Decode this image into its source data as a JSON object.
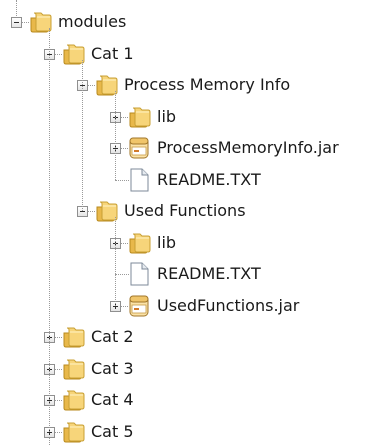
{
  "tree": {
    "label": "modules",
    "icon": "folder-icon",
    "expanded": true,
    "children": [
      {
        "label": "Cat 1",
        "icon": "folder-icon",
        "expanded": true,
        "children": [
          {
            "label": "Process Memory Info",
            "icon": "folder-icon",
            "expanded": true,
            "children": [
              {
                "label": "lib",
                "icon": "folder-icon",
                "expanded": false,
                "hasChildren": true
              },
              {
                "label": "ProcessMemoryInfo.jar",
                "icon": "jar-file-icon",
                "expanded": false,
                "hasChildren": true
              },
              {
                "label": "README.TXT",
                "icon": "text-file-icon"
              }
            ]
          },
          {
            "label": "Used Functions",
            "icon": "folder-icon",
            "expanded": true,
            "children": [
              {
                "label": "lib",
                "icon": "folder-icon",
                "expanded": false,
                "hasChildren": true
              },
              {
                "label": "README.TXT",
                "icon": "text-file-icon"
              },
              {
                "label": "UsedFunctions.jar",
                "icon": "jar-file-icon",
                "expanded": false,
                "hasChildren": true
              }
            ]
          }
        ]
      },
      {
        "label": "Cat 2",
        "icon": "folder-icon",
        "expanded": false,
        "hasChildren": true
      },
      {
        "label": "Cat 3",
        "icon": "folder-icon",
        "expanded": false,
        "hasChildren": true
      },
      {
        "label": "Cat 4",
        "icon": "folder-icon",
        "expanded": false,
        "hasChildren": true
      },
      {
        "label": "Cat 5",
        "icon": "folder-icon",
        "expanded": false,
        "hasChildren": true
      }
    ]
  }
}
